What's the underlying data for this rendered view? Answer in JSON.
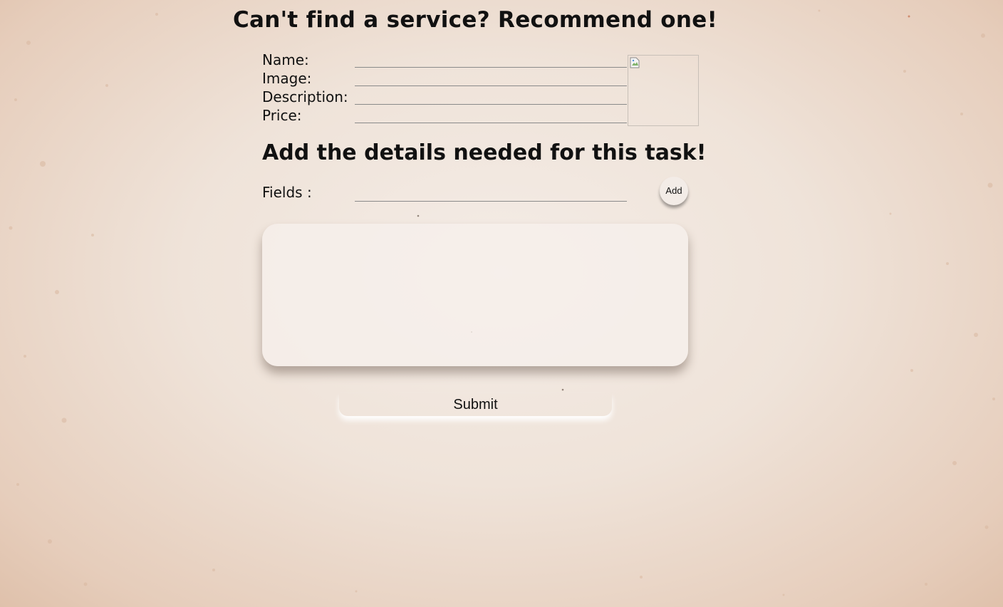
{
  "page": {
    "title": "Can't find a service? Recommend one!"
  },
  "service_form": {
    "name_label": "Name:",
    "image_label": "Image:",
    "description_label": "Description:",
    "price_label": "Price:",
    "name_value": "",
    "image_value": "",
    "description_value": "",
    "price_value": ""
  },
  "image_preview": {
    "icon": "broken-image-icon"
  },
  "task_details": {
    "heading": "Add the details needed for this task!",
    "fields_label": "Fields :",
    "fields_value": "",
    "add_label": "Add"
  },
  "fields_list": {
    "items": []
  },
  "actions": {
    "submit_label": "Submit"
  },
  "colors": {
    "background": "#f0e5dc",
    "text": "#111111",
    "box": "#f6f0ec"
  }
}
